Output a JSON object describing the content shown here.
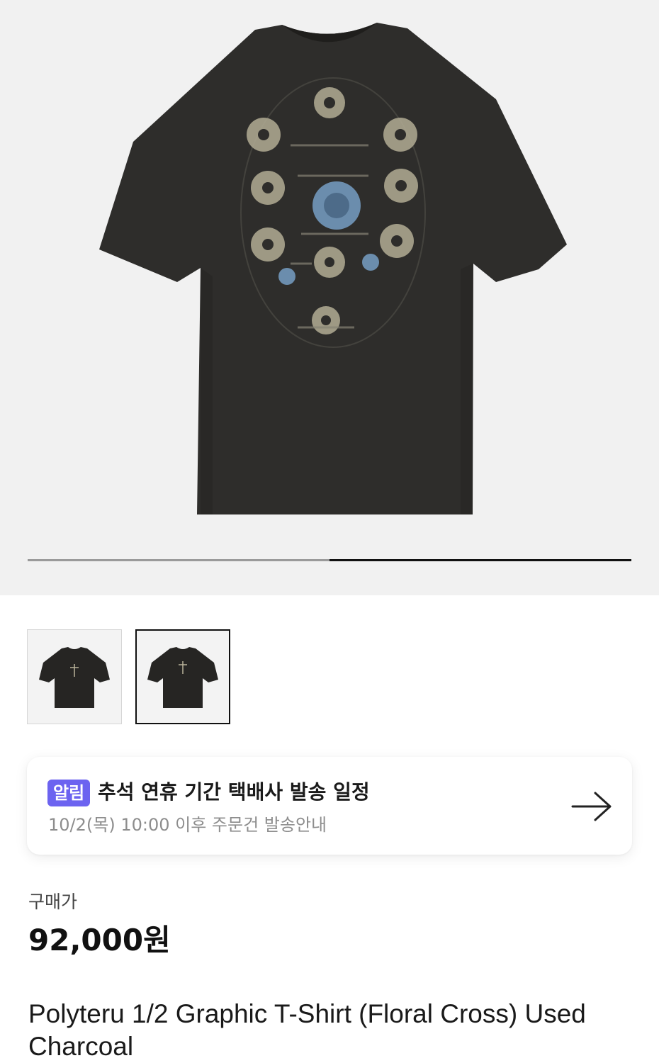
{
  "gallery": {
    "main_image": "product-back-view-image",
    "progress": 0.5,
    "thumbnails": [
      {
        "name": "thumbnail-front",
        "selected": false
      },
      {
        "name": "thumbnail-back",
        "selected": true
      }
    ]
  },
  "notice": {
    "badge": "알림",
    "title": "추석 연휴 기간 택배사 발송 일정",
    "subtitle": "10/2(목) 10:00 이후 주문건 발송안내",
    "icon": "arrow-right-icon",
    "badge_color": "#6c63f0"
  },
  "price": {
    "label": "구매가",
    "value": "92,000원"
  },
  "product": {
    "name": "Polyteru 1/2 Graphic T-Shirt (Floral Cross) Used Charcoal"
  },
  "colors": {
    "shirt": "#2e2d2b",
    "graphic_flower": "#b9b39a",
    "graphic_rose": "#6f93b4"
  }
}
